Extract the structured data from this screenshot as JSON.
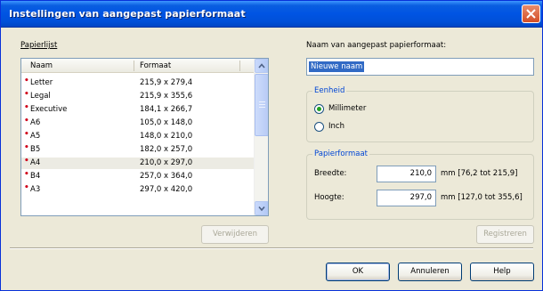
{
  "window": {
    "title": "Instellingen van aangepast papierformaat"
  },
  "paperlist": {
    "label": "Papierlijst",
    "col_name": "Naam",
    "col_format": "Formaat",
    "rows": [
      {
        "name": "Letter",
        "format": "215,9 x 279,4",
        "selected": false
      },
      {
        "name": "Legal",
        "format": "215,9 x 355,6",
        "selected": false
      },
      {
        "name": "Executive",
        "format": "184,1 x 266,7",
        "selected": false
      },
      {
        "name": "A6",
        "format": "105,0 x 148,0",
        "selected": false
      },
      {
        "name": "A5",
        "format": "148,0 x 210,0",
        "selected": false
      },
      {
        "name": "B5",
        "format": "182,0 x 257,0",
        "selected": false
      },
      {
        "name": "A4",
        "format": "210,0 x 297,0",
        "selected": true
      },
      {
        "name": "B4",
        "format": "257,0 x 364,0",
        "selected": false
      },
      {
        "name": "A3",
        "format": "297,0 x 420,0",
        "selected": false
      }
    ],
    "remove_button": "Verwijderen"
  },
  "custom_name": {
    "label": "Naam van aangepast papierformaat:",
    "value": "Nieuwe naam"
  },
  "unit": {
    "group_title": "Eenheid",
    "options": [
      {
        "label": "Millimeter",
        "checked": true
      },
      {
        "label": "Inch",
        "checked": false
      }
    ]
  },
  "paper_format": {
    "group_title": "Papierformaat",
    "width_label": "Breedte:",
    "width_value": "210,0",
    "width_range": "mm [76,2 tot 215,9]",
    "height_label": "Hoogte:",
    "height_value": "297,0",
    "height_range": "mm [127,0 tot 355,6]"
  },
  "register_button": "Registreren",
  "footer": {
    "ok": "OK",
    "cancel": "Annuleren",
    "help": "Help"
  }
}
